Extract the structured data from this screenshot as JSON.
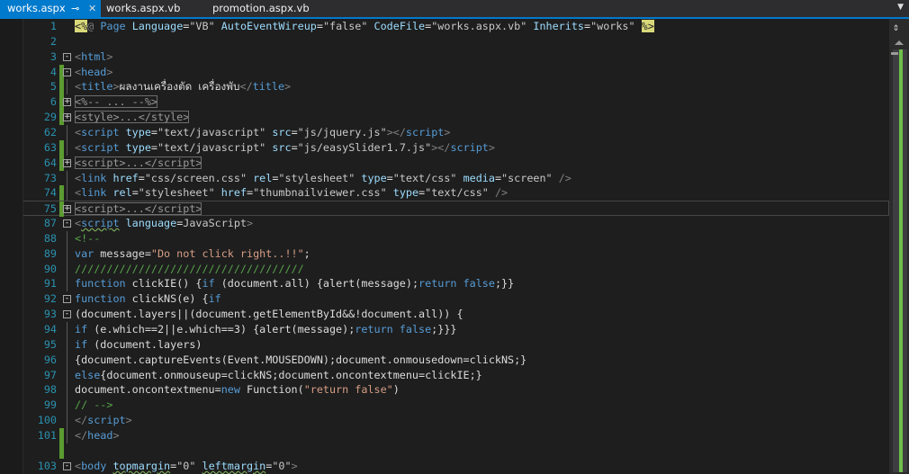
{
  "tabs": [
    {
      "label": "works.aspx",
      "active": true,
      "pin": "⊸",
      "close": "✕"
    },
    {
      "label": "works.aspx.vb"
    },
    {
      "label": "promotion.aspx.vb"
    }
  ],
  "tab_overflow": "▼",
  "scrollbar": {
    "split_icon": "⇕",
    "position": 0.0,
    "accent": "#6fc04a"
  },
  "colors": {
    "accent": "#007acc",
    "change_bar": "#5b9b31",
    "line_number": "#2b91af"
  },
  "lines": [
    {
      "n": "1",
      "segs": [
        [
          "hl",
          "<%"
        ],
        [
          "d",
          "@ "
        ],
        [
          "t",
          "Page "
        ],
        [
          "a",
          "Language"
        ],
        [
          "x",
          "="
        ],
        [
          "v",
          "\"VB\" "
        ],
        [
          "a",
          "AutoEventWireup"
        ],
        [
          "x",
          "="
        ],
        [
          "v",
          "\"false\" "
        ],
        [
          "a",
          "CodeFile"
        ],
        [
          "x",
          "="
        ],
        [
          "v",
          "\"works.aspx.vb\" "
        ],
        [
          "a",
          "Inherits"
        ],
        [
          "x",
          "="
        ],
        [
          "v",
          "\"works\" "
        ],
        [
          "hl",
          "%>"
        ]
      ]
    },
    {
      "n": "2",
      "segs": []
    },
    {
      "n": "3",
      "fold": "-",
      "segs": [
        [
          "d",
          "<"
        ],
        [
          "t",
          "html"
        ],
        [
          "d",
          ">"
        ]
      ]
    },
    {
      "n": "4",
      "fold": "-",
      "chg": true,
      "segs": [
        [
          "d",
          "<"
        ],
        [
          "t",
          "head"
        ],
        [
          "d",
          ">"
        ]
      ]
    },
    {
      "n": "5",
      "chg": true,
      "line": true,
      "segs": [
        [
          "d",
          "<"
        ],
        [
          "t",
          "title"
        ],
        [
          "d",
          ">"
        ],
        [
          "th",
          "ผลงานเครื่องตัด เครื่องพับ"
        ],
        [
          "d",
          "</"
        ],
        [
          "t",
          "title"
        ],
        [
          "d",
          ">"
        ]
      ]
    },
    {
      "n": "6",
      "fold": "+",
      "chg": true,
      "segs": [
        [
          "o",
          "<%-- ... --%>"
        ]
      ]
    },
    {
      "n": "29",
      "fold": "+",
      "chg": true,
      "segs": [
        [
          "o",
          "<style>...</style>"
        ]
      ]
    },
    {
      "n": "62",
      "line": true,
      "segs": [
        [
          "d",
          "<"
        ],
        [
          "t",
          "script "
        ],
        [
          "a",
          "type"
        ],
        [
          "x",
          "="
        ],
        [
          "v",
          "\"text/javascript\" "
        ],
        [
          "a",
          "src"
        ],
        [
          "x",
          "="
        ],
        [
          "v",
          "\"js/jquery.js\""
        ],
        [
          "d",
          "></"
        ],
        [
          "t",
          "script"
        ],
        [
          "d",
          ">"
        ]
      ]
    },
    {
      "n": "63",
      "chg": true,
      "line": true,
      "segs": [
        [
          "d",
          "<"
        ],
        [
          "t",
          "script "
        ],
        [
          "a",
          "type"
        ],
        [
          "x",
          "="
        ],
        [
          "v",
          "\"text/javascript\" "
        ],
        [
          "a",
          "src"
        ],
        [
          "x",
          "="
        ],
        [
          "v",
          "\"js/easySlider1.7.js\""
        ],
        [
          "d",
          "></"
        ],
        [
          "t",
          "script"
        ],
        [
          "d",
          ">"
        ]
      ]
    },
    {
      "n": "64",
      "fold": "+",
      "chg": true,
      "segs": [
        [
          "o",
          "<script>...</script>"
        ]
      ]
    },
    {
      "n": "73",
      "line": true,
      "segs": [
        [
          "d",
          "<"
        ],
        [
          "t",
          "link "
        ],
        [
          "a",
          "href"
        ],
        [
          "x",
          "="
        ],
        [
          "v",
          "\"css/screen.css\" "
        ],
        [
          "a",
          "rel"
        ],
        [
          "x",
          "="
        ],
        [
          "v",
          "\"stylesheet\" "
        ],
        [
          "a",
          "type"
        ],
        [
          "x",
          "="
        ],
        [
          "v",
          "\"text/css\" "
        ],
        [
          "a",
          "media"
        ],
        [
          "x",
          "="
        ],
        [
          "v",
          "\"screen\" "
        ],
        [
          "d",
          "/>"
        ]
      ]
    },
    {
      "n": "74",
      "chg": true,
      "line": true,
      "segs": [
        [
          "d",
          "<"
        ],
        [
          "t",
          "link "
        ],
        [
          "a",
          "rel"
        ],
        [
          "x",
          "="
        ],
        [
          "v",
          "\"stylesheet\" "
        ],
        [
          "a",
          "href"
        ],
        [
          "x",
          "="
        ],
        [
          "v",
          "\"thumbnailviewer.css\" "
        ],
        [
          "a",
          "type"
        ],
        [
          "x",
          "="
        ],
        [
          "v",
          "\"text/css\" "
        ],
        [
          "d",
          "/>"
        ]
      ]
    },
    {
      "n": "75",
      "fold": "+",
      "chg": true,
      "cur": true,
      "segs": [
        [
          "o",
          "<script>...</script>"
        ]
      ]
    },
    {
      "n": "87",
      "fold": "-",
      "segs": [
        [
          "d",
          "<"
        ],
        [
          "t sq",
          "script"
        ],
        [
          "t",
          " "
        ],
        [
          "a",
          "language"
        ],
        [
          "x",
          "="
        ],
        [
          "v",
          "JavaScript"
        ],
        [
          "d",
          ">"
        ]
      ]
    },
    {
      "n": "88",
      "line": true,
      "segs": [
        [
          "c",
          "<!--"
        ]
      ]
    },
    {
      "n": "89",
      "line": true,
      "segs": [
        [
          "k",
          "var "
        ],
        [
          "x",
          "message="
        ],
        [
          "s",
          "\"Do not click right..!!\""
        ],
        [
          "x",
          ";"
        ]
      ]
    },
    {
      "n": "90",
      "line": true,
      "segs": [
        [
          "c",
          "////////////////////////////////////"
        ]
      ]
    },
    {
      "n": "91",
      "line": true,
      "segs": [
        [
          "k",
          "function "
        ],
        [
          "x",
          "clickIE() {"
        ],
        [
          "k",
          "if "
        ],
        [
          "x",
          "(document.all) {alert(message);"
        ],
        [
          "k",
          "return false"
        ],
        [
          "x",
          ";}}"
        ]
      ]
    },
    {
      "n": "92",
      "fold": "-",
      "segs": [
        [
          "k",
          "function "
        ],
        [
          "x",
          "clickNS(e) {"
        ],
        [
          "k",
          "if"
        ]
      ]
    },
    {
      "n": "93",
      "fold": "-",
      "segs": [
        [
          "x",
          "(document.layers||(document.getElementById&&!document.all)) {"
        ]
      ]
    },
    {
      "n": "94",
      "line": true,
      "segs": [
        [
          "k",
          "if "
        ],
        [
          "x",
          "(e.which==2||e.which==3) {alert(message);"
        ],
        [
          "k",
          "return false"
        ],
        [
          "x",
          ";}}}"
        ]
      ]
    },
    {
      "n": "95",
      "line": true,
      "segs": [
        [
          "k",
          "if "
        ],
        [
          "x",
          "(document.layers)"
        ]
      ]
    },
    {
      "n": "96",
      "line": true,
      "segs": [
        [
          "x",
          "{document.captureEvents(Event.MOUSEDOWN);document.onmousedown=clickNS;}"
        ]
      ]
    },
    {
      "n": "97",
      "line": true,
      "segs": [
        [
          "k",
          "else"
        ],
        [
          "x",
          "{document.onmouseup=clickNS;document.oncontextmenu=clickIE;}"
        ]
      ]
    },
    {
      "n": "98",
      "line": true,
      "segs": [
        [
          "x",
          "document.oncontextmenu="
        ],
        [
          "k",
          "new "
        ],
        [
          "x",
          "Function("
        ],
        [
          "s",
          "\"return false\""
        ],
        [
          "x",
          ")"
        ]
      ]
    },
    {
      "n": "99",
      "line": true,
      "segs": [
        [
          "c",
          "// -->"
        ]
      ]
    },
    {
      "n": "100",
      "line": true,
      "segs": [
        [
          "d",
          "</"
        ],
        [
          "t",
          "script"
        ],
        [
          "d",
          ">"
        ]
      ]
    },
    {
      "n": "101",
      "chg": true,
      "line": true,
      "segs": [
        [
          "d",
          "</"
        ],
        [
          "t",
          "head"
        ],
        [
          "d",
          ">"
        ]
      ]
    },
    {
      "n": "",
      "chg": true,
      "segs": []
    },
    {
      "n": "103",
      "fold": "-",
      "segs": [
        [
          "d",
          "<"
        ],
        [
          "t",
          "body "
        ],
        [
          "a sq",
          "topmargin"
        ],
        [
          "x",
          "="
        ],
        [
          "v",
          "\"0\" "
        ],
        [
          "a sq",
          "leftmargin"
        ],
        [
          "x",
          "="
        ],
        [
          "v",
          "\"0\""
        ],
        [
          "d",
          ">"
        ]
      ]
    }
  ]
}
